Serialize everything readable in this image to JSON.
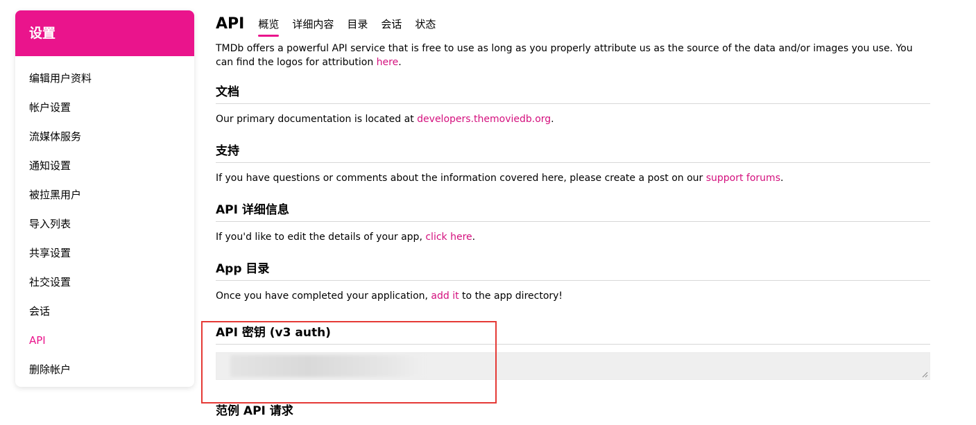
{
  "sidebar": {
    "title": "设置",
    "items": [
      {
        "label": "编辑用户资料"
      },
      {
        "label": "帐户设置"
      },
      {
        "label": "流媒体服务"
      },
      {
        "label": "通知设置"
      },
      {
        "label": "被拉黑用户"
      },
      {
        "label": "导入列表"
      },
      {
        "label": "共享设置"
      },
      {
        "label": "社交设置"
      },
      {
        "label": "会话"
      },
      {
        "label": "API",
        "active": true
      },
      {
        "label": "删除帐户"
      }
    ]
  },
  "header": {
    "title": "API",
    "tabs": [
      "概览",
      "详细内容",
      "目录",
      "会话",
      "状态"
    ]
  },
  "intro": {
    "text1": "TMDb offers a powerful API service that is free to use as long as you properly attribute us as the source of the data and/or images you use. You can find the logos for attribution ",
    "link": "here",
    "text2": "."
  },
  "docs": {
    "heading": "文档",
    "text1": "Our primary documentation is located at ",
    "link": "developers.themoviedb.org",
    "text2": "."
  },
  "support": {
    "heading": "支持",
    "text1": "If you have questions or comments about the information covered here, please create a post on our ",
    "link": "support forums",
    "text2": "."
  },
  "api_details": {
    "heading": "API 详细信息",
    "text1": "If you'd like to edit the details of your app, ",
    "link": "click here",
    "text2": "."
  },
  "app_directory": {
    "heading": "App 目录",
    "text1": "Once you have completed your application, ",
    "link": "add it",
    "text2": " to the app directory!"
  },
  "api_key": {
    "heading": "API 密钥 (v3 auth)"
  },
  "example": {
    "heading": "范例 API 请求"
  },
  "colors": {
    "brand": "#ea148c",
    "link": "#d40f7d",
    "highlight": "#e53935"
  }
}
